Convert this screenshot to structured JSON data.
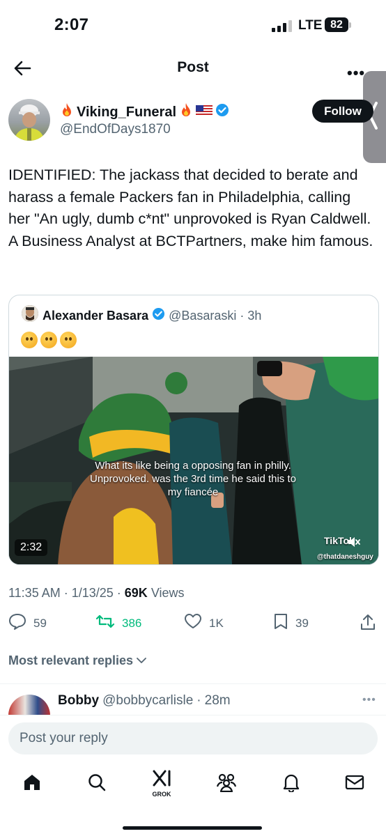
{
  "status_bar": {
    "time": "2:07",
    "network": "LTE",
    "battery": "82"
  },
  "header": {
    "title": "Post"
  },
  "author": {
    "name": "Viking_Funeral",
    "handle": "@EndOfDays1870",
    "follow_label": "Follow"
  },
  "post": {
    "text": "IDENTIFIED:  The jackass that decided to berate and harass a female Packers fan in Philadelphia, calling her \"An ugly, dumb c*nt\" unprovoked is Ryan Caldwell.  A Business Analyst at BCTPartners, make him famous."
  },
  "quote": {
    "name": "Alexander Basara",
    "handle": "@Basaraski",
    "time": "3h",
    "caption": "What its like being a opposing fan in philly. Unprovoked. was the 3rd time he said this to my fiancée",
    "duration": "2:32",
    "watermark": "TikTok",
    "watermark_user": "@thatdaneshguy"
  },
  "meta": {
    "time": "11:35 AM",
    "date": "1/13/25",
    "views": "69K",
    "views_label": "Views"
  },
  "actions": {
    "replies": "59",
    "reposts": "386",
    "likes": "1K",
    "bookmarks": "39"
  },
  "replies_filter": "Most relevant replies",
  "reply": {
    "name": "Bobby",
    "handle": "@bobbycarlisle",
    "time": "28m"
  },
  "composer": {
    "placeholder": "Post your reply"
  },
  "tabbar": {
    "grok_label": "GROK"
  },
  "colors": {
    "accent": "#1d9bf0",
    "repost_green": "#00ba7c",
    "muted": "#536471"
  }
}
